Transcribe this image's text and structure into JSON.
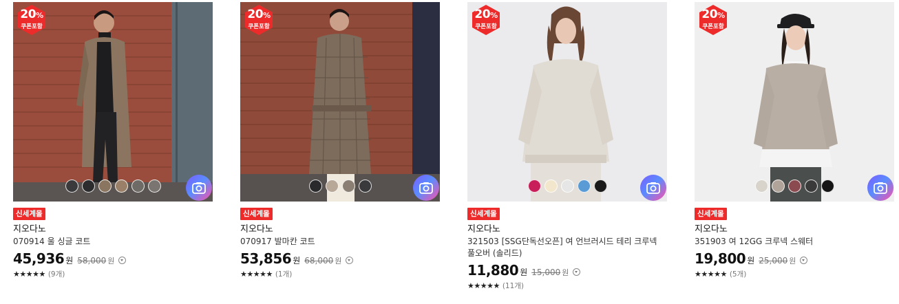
{
  "products": [
    {
      "coupon_percent": "20",
      "coupon_unit": "%",
      "coupon_label": "쿠폰포함",
      "tag": "신세계몰",
      "brand": "지오다노",
      "name": "070914 울 싱글 코트",
      "price": "45,936",
      "currency": "원",
      "original_price": "58,000",
      "original_currency": "원",
      "stars": "★★★★★",
      "review_count": "(9개)",
      "swatches": [
        "#3a3a3c",
        "#2c2c2e",
        "#8a7560",
        "#9a8068",
        "#6e6a66",
        "#7a7570"
      ],
      "image_bg": "#9a4d3c",
      "icon": "camera-icon"
    },
    {
      "coupon_percent": "20",
      "coupon_unit": "%",
      "coupon_label": "쿠폰포함",
      "tag": "신세계몰",
      "brand": "지오다노",
      "name": "070917 발마칸 코트",
      "price": "53,856",
      "currency": "원",
      "original_price": "68,000",
      "original_currency": "원",
      "stars": "★★★★★",
      "review_count": "(1개)",
      "swatches": [
        "#2a2a2c",
        "#b8a898",
        "#8a7f72",
        "#3a3a3c"
      ],
      "image_bg": "#8f4a3a",
      "icon": "camera-icon"
    },
    {
      "coupon_percent": "20",
      "coupon_unit": "%",
      "coupon_label": "쿠폰포함",
      "tag": "신세계몰",
      "brand": "지오다노",
      "name": "321503 [SSG단독선오픈] 여 언브러시드 테리 크루넥 풀오버 (솔리드)",
      "price": "11,880",
      "currency": "원",
      "original_price": "15,000",
      "original_currency": "원",
      "stars": "★★★★★",
      "review_count": "(11개)",
      "swatches": [
        "#c81e5a",
        "#f2e6cc",
        "#e6e6e6",
        "#5b9bd5",
        "#1a1a1a"
      ],
      "image_bg": "#ebebed",
      "icon": "camera-icon"
    },
    {
      "coupon_percent": "20",
      "coupon_unit": "%",
      "coupon_label": "쿠폰포함",
      "tag": "신세계몰",
      "brand": "지오다노",
      "name": "351903 여 12GG 크루넥 스웨터",
      "price": "19,800",
      "currency": "원",
      "original_price": "25,000",
      "original_currency": "원",
      "stars": "★★★★★",
      "review_count": "(5개)",
      "swatches": [
        "#d8d4cc",
        "#b0a49a",
        "#8a4a50",
        "#3a3a3a",
        "#151515"
      ],
      "image_bg": "#efefef",
      "icon": "camera-icon"
    }
  ],
  "colors": {
    "coupon_badge": "#ee2b2b",
    "tag_bg": "#ee2b2b",
    "camera_gradient": [
      "#7b5cff",
      "#5a8cff",
      "#ff4fa8"
    ]
  }
}
